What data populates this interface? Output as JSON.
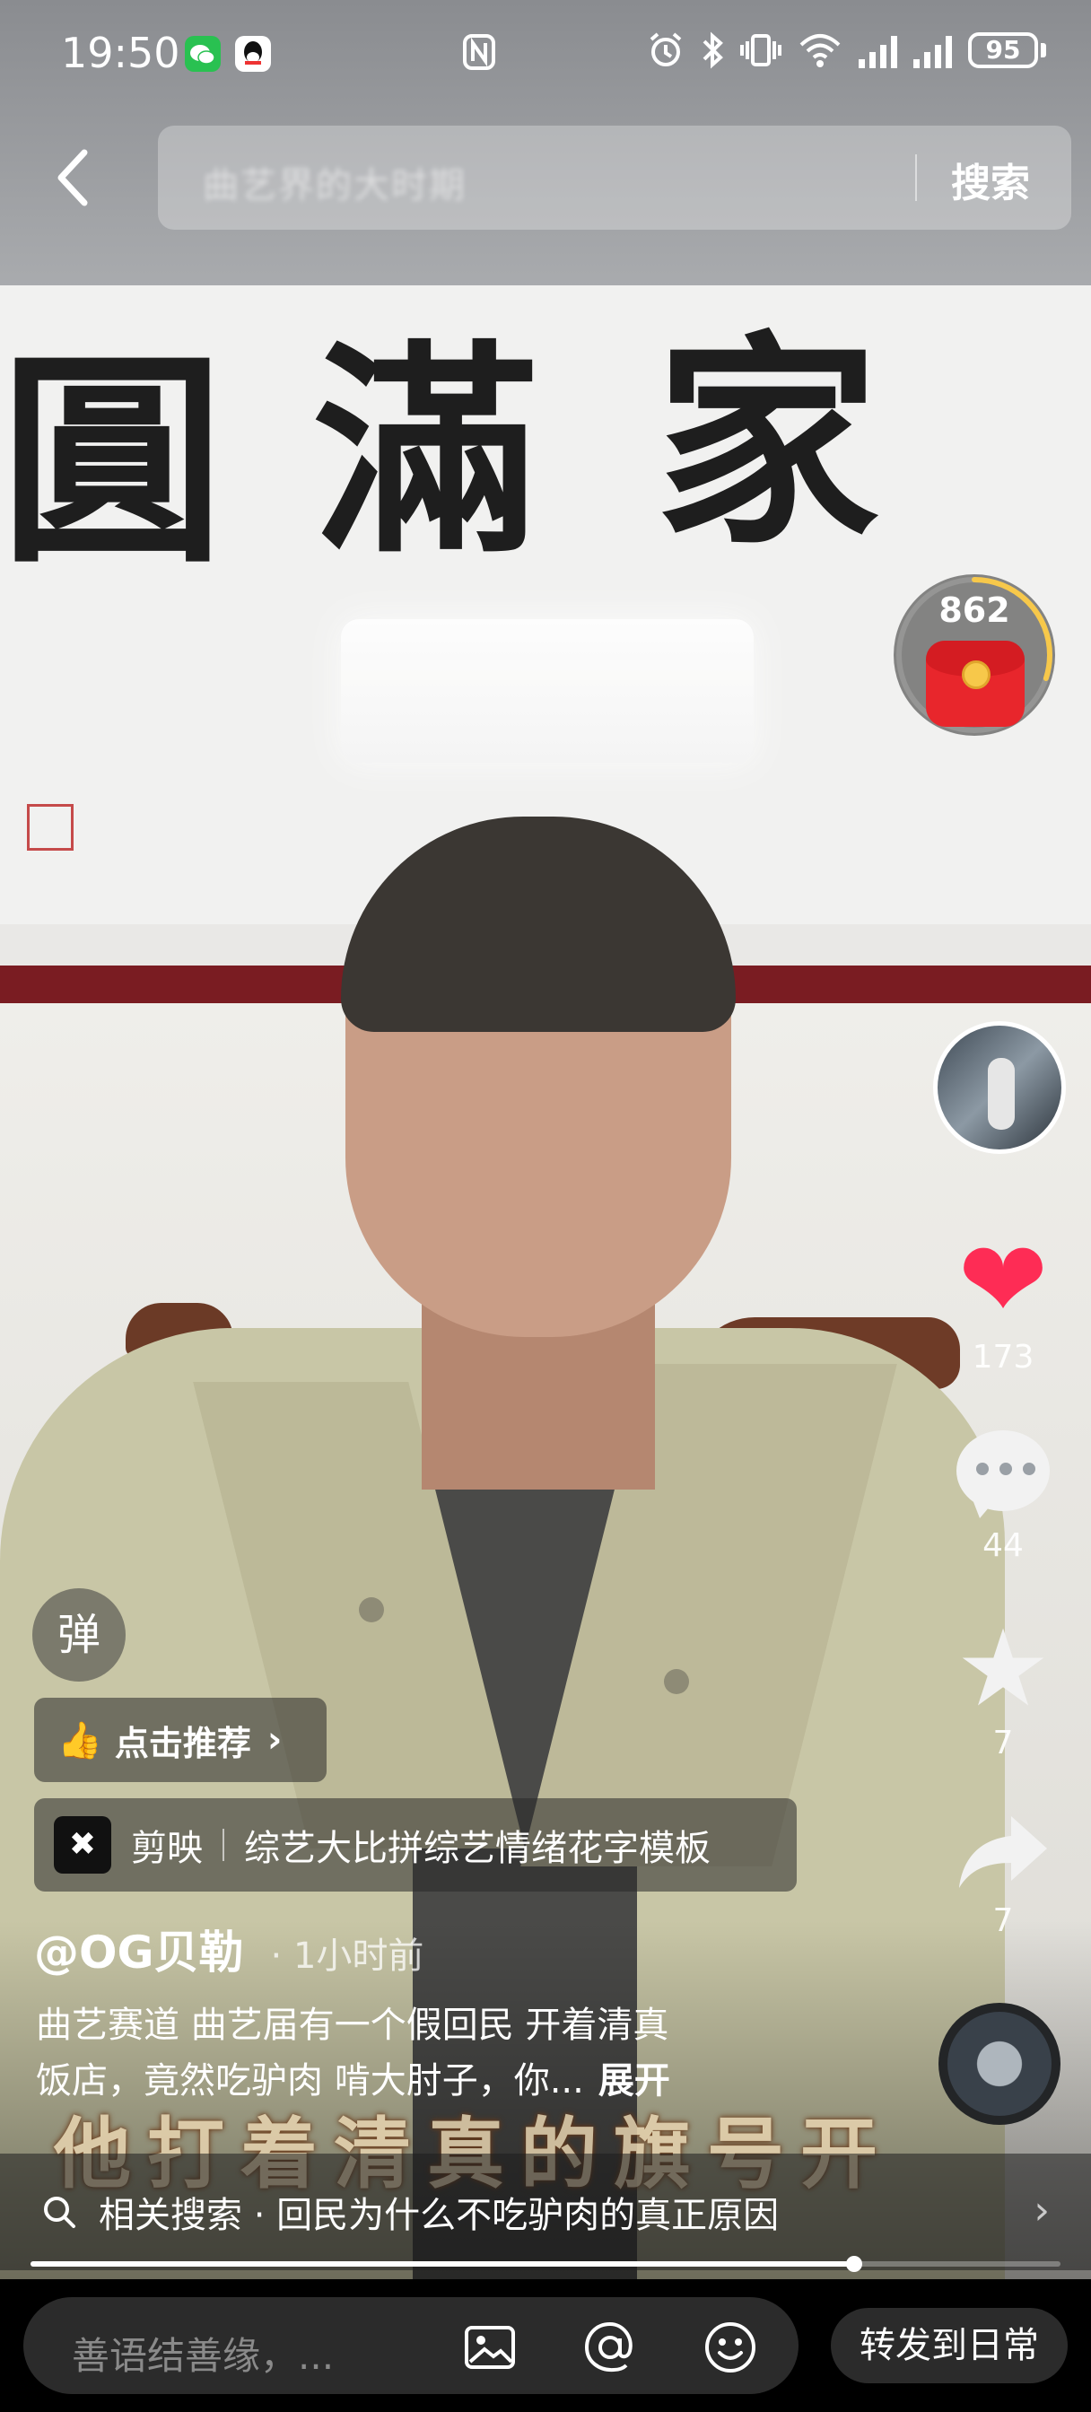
{
  "status_bar": {
    "time": "19:50",
    "battery": "95",
    "app_icons": [
      "wechat-icon",
      "qq-icon"
    ],
    "right_icons": [
      "nfc-icon",
      "alarm-icon",
      "bluetooth-icon",
      "vibrate-icon",
      "wifi-icon",
      "signal-icon",
      "signal-icon"
    ]
  },
  "search": {
    "placeholder": "曲艺界的大时期",
    "button_label": "搜索"
  },
  "red_packet": {
    "count": "862",
    "progress": 0.3
  },
  "actions": {
    "likes": "173",
    "comments": "44",
    "favorites": "7",
    "shares": "7"
  },
  "overlay": {
    "danmu_label": "弹",
    "recommend_label": "点击推荐",
    "capcut_app": "剪映",
    "capcut_template": "综艺大比拼综艺情绪花字模板",
    "author": "@OG贝勒",
    "time_ago": "· 1小时前",
    "description_line1": "曲艺赛道 曲艺届有一个假回民 开着清真",
    "description_line2": "饭店，竟然吃驴肉 啃大肘子，你...",
    "expand_label": "展开",
    "subtitle": "他打着清真的旗号开"
  },
  "related_search": {
    "label": "相关搜索 · 回民为什么不吃驴肉的真正原因"
  },
  "video_progress": 0.8,
  "bottom_bar": {
    "comment_placeholder": "善语结善缘，...",
    "repost_label": "转发到日常"
  },
  "colors": {
    "like_red": "#fe2c55",
    "red_packet": "#e8262c",
    "accent_gold": "#f7c84a"
  }
}
